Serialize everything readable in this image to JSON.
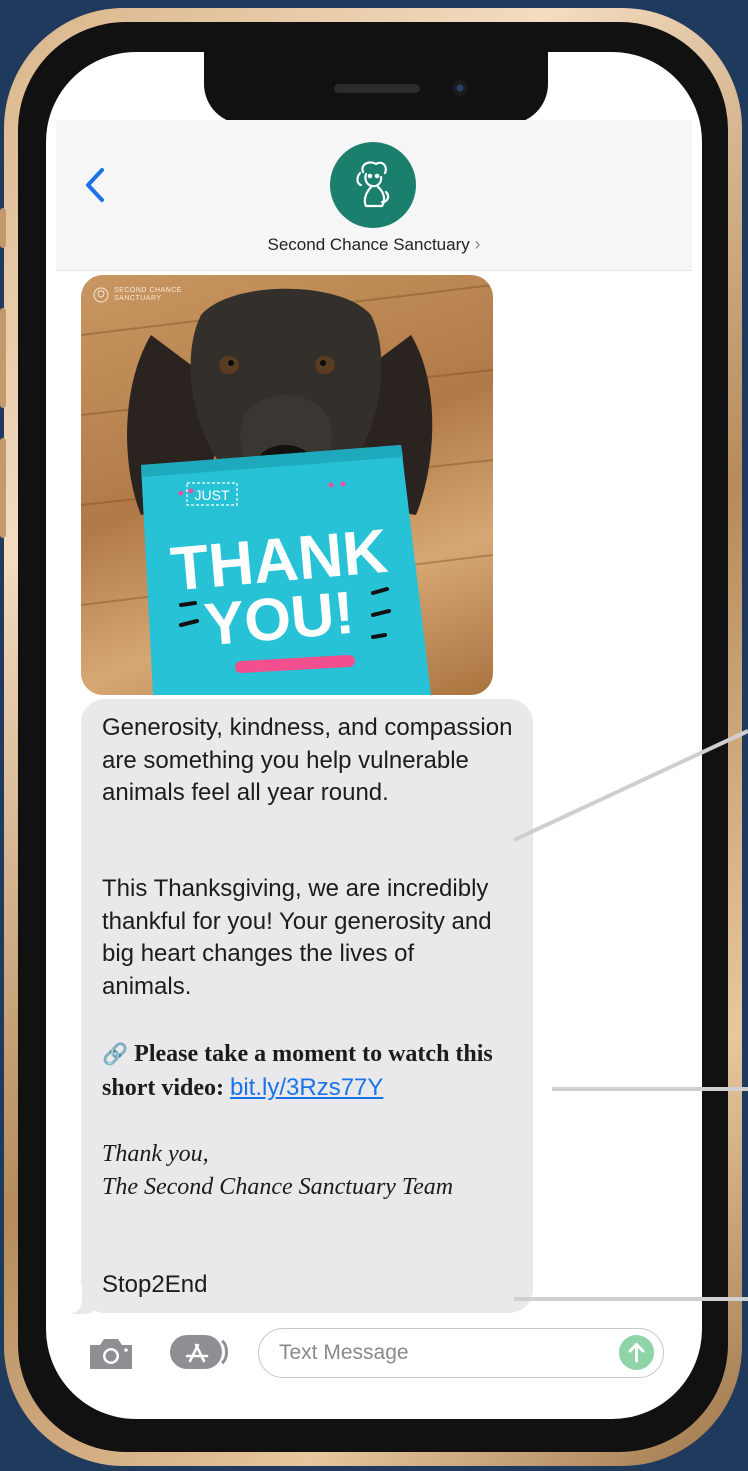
{
  "header": {
    "contact_name": "Second Chance Sanctuary",
    "name_chevron": "›"
  },
  "photo": {
    "brand_line1": "SECOND CHANCE",
    "brand_line2": "SANCTUARY",
    "card_small": "JUST",
    "card_line1": "THANK",
    "card_line2": "YOU!"
  },
  "message": {
    "para1": "Generosity, kindness, and compassion are something you help vulnerable animals feel all year round.",
    "para2": "This Thanksgiving, we are incredibly thankful for you! Your generosity and big heart changes the lives of animals.",
    "para3_emoji": "🔗",
    "para3_bold": "Please take a moment to watch this short video:",
    "link": "bit.ly/3Rzs77Y",
    "signoff1": "Thank you,",
    "signoff2": "The Second Chance Sanctuary Team",
    "optout": "Stop2End"
  },
  "input_bar": {
    "placeholder": "Text Message"
  },
  "colors": {
    "background": "#1f3a5c",
    "avatar": "#1b7f6e",
    "bubble": "#e9e9eb",
    "link": "#1a73e8",
    "send": "#8fd4a6"
  }
}
